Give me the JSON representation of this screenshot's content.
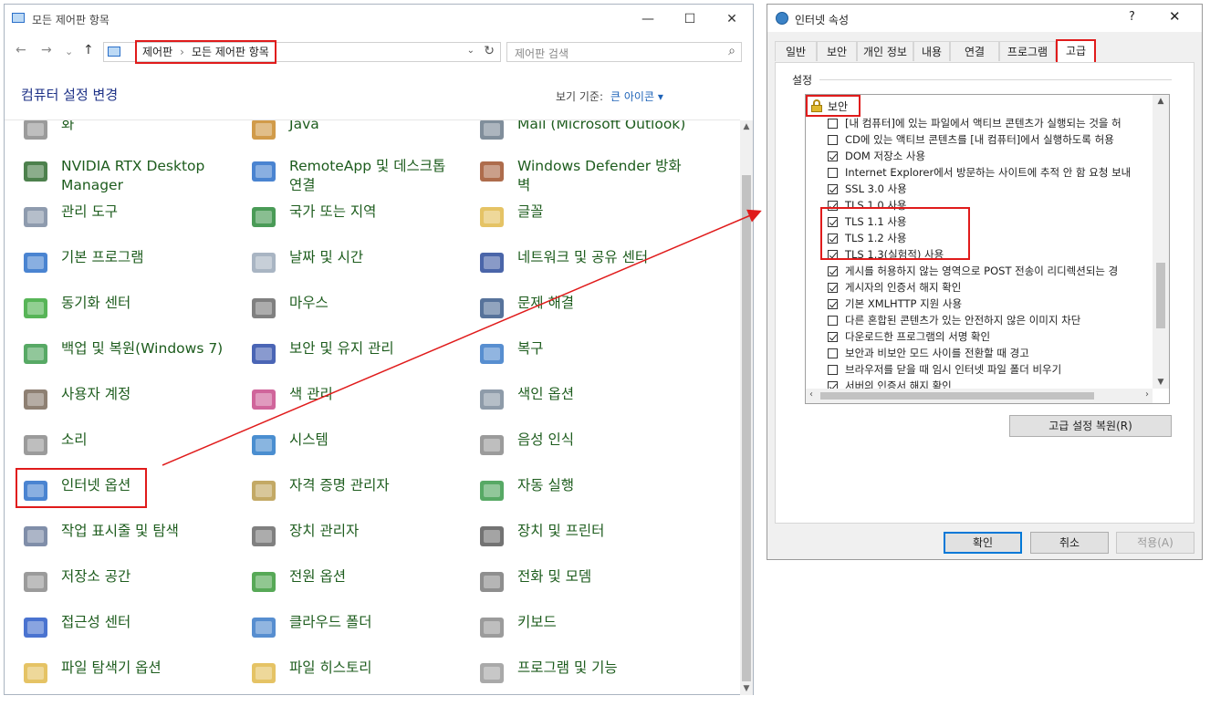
{
  "control_panel": {
    "title": "모든 제어판 항목",
    "caption_buttons": {
      "minimize": "—",
      "maximize": "☐",
      "close": "✕"
    },
    "nav": {
      "back": "←",
      "forward": "→",
      "dropdown": "⌄",
      "up": "↑"
    },
    "breadcrumb": {
      "root": "제어판",
      "separator": "›",
      "current": "모든 제어판 항목"
    },
    "address_dropdown": "⌄",
    "refresh": "↻",
    "search_placeholder": "제어판 검색",
    "search_icon": "⌕",
    "heading": "컴퓨터 설정 변경",
    "view_by_label": "보기 기준:",
    "view_by_value": "큰 아이콘 ▾",
    "scroll_up": "▲",
    "scroll_down": "▼",
    "items": [
      {
        "label": "화",
        "icon": "keys-icon"
      },
      {
        "label": "Java",
        "icon": "java-icon"
      },
      {
        "label": "Mail (Microsoft Outlook)",
        "icon": "mail-icon"
      },
      {
        "label": "NVIDIA RTX Desktop Manager",
        "icon": "nvidia-icon"
      },
      {
        "label": "RemoteApp 및 데스크톱 연결",
        "icon": "remoteapp-icon"
      },
      {
        "label": "Windows Defender 방화벽",
        "icon": "firewall-icon"
      },
      {
        "label": "관리 도구",
        "icon": "admin-tools-icon"
      },
      {
        "label": "국가 또는 지역",
        "icon": "globe-clock-icon"
      },
      {
        "label": "글꼴",
        "icon": "font-folder-icon"
      },
      {
        "label": "기본 프로그램",
        "icon": "default-programs-icon"
      },
      {
        "label": "날짜 및 시간",
        "icon": "calendar-clock-icon"
      },
      {
        "label": "네트워크 및 공유 센터",
        "icon": "network-icon"
      },
      {
        "label": "동기화 센터",
        "icon": "sync-icon"
      },
      {
        "label": "마우스",
        "icon": "mouse-icon"
      },
      {
        "label": "문제 해결",
        "icon": "troubleshoot-icon"
      },
      {
        "label": "백업 및 복원(Windows 7)",
        "icon": "backup-icon"
      },
      {
        "label": "보안 및 유지 관리",
        "icon": "flag-icon"
      },
      {
        "label": "복구",
        "icon": "recovery-icon"
      },
      {
        "label": "사용자 계정",
        "icon": "users-icon"
      },
      {
        "label": "색 관리",
        "icon": "color-management-icon"
      },
      {
        "label": "색인 옵션",
        "icon": "indexing-icon"
      },
      {
        "label": "소리",
        "icon": "speaker-icon"
      },
      {
        "label": "시스템",
        "icon": "system-icon"
      },
      {
        "label": "음성 인식",
        "icon": "microphone-icon"
      },
      {
        "label": "인터넷 옵션",
        "icon": "internet-options-icon"
      },
      {
        "label": "자격 증명 관리자",
        "icon": "credential-vault-icon"
      },
      {
        "label": "자동 실행",
        "icon": "autoplay-icon"
      },
      {
        "label": "작업 표시줄 및 탐색",
        "icon": "taskbar-icon"
      },
      {
        "label": "장치 관리자",
        "icon": "device-manager-icon"
      },
      {
        "label": "장치 및 프린터",
        "icon": "printer-icon"
      },
      {
        "label": "저장소 공간",
        "icon": "storage-icon"
      },
      {
        "label": "전원 옵션",
        "icon": "battery-icon"
      },
      {
        "label": "전화 및 모뎀",
        "icon": "phone-icon"
      },
      {
        "label": "접근성 센터",
        "icon": "accessibility-icon"
      },
      {
        "label": "클라우드 폴더",
        "icon": "cloud-folder-icon"
      },
      {
        "label": "키보드",
        "icon": "keyboard-icon"
      },
      {
        "label": "파일 탐색기 옵션",
        "icon": "folder-options-icon"
      },
      {
        "label": "파일 히스토리",
        "icon": "file-history-icon"
      },
      {
        "label": "프로그램 및 기능",
        "icon": "programs-features-icon"
      }
    ]
  },
  "internet_properties": {
    "title": "인터넷 속성",
    "help": "?",
    "close": "✕",
    "tabs": [
      "일반",
      "보안",
      "개인 정보",
      "내용",
      "연결",
      "프로그램",
      "고급"
    ],
    "active_tab": "고급",
    "group_label": "설정",
    "category": "보안",
    "scroll_up": "▲",
    "scroll_down": "▼",
    "scroll_left": "‹",
    "scroll_right": "›",
    "options": [
      {
        "label": "[내 컴퓨터]에 있는 파일에서 액티브 콘텐츠가 실행되는 것을 허",
        "checked": false
      },
      {
        "label": "CD에 있는 액티브 콘텐츠를 [내 컴퓨터]에서 실행하도록 허용",
        "checked": false
      },
      {
        "label": "DOM 저장소 사용",
        "checked": true
      },
      {
        "label": "Internet Explorer에서 방문하는 사이트에 추적 안 함 요청 보내",
        "checked": false
      },
      {
        "label": "SSL 3.0 사용",
        "checked": true
      },
      {
        "label": "TLS 1.0 사용",
        "checked": true
      },
      {
        "label": "TLS 1.1 사용",
        "checked": true
      },
      {
        "label": "TLS 1.2 사용",
        "checked": true
      },
      {
        "label": "TLS 1.3(실험적) 사용",
        "checked": true
      },
      {
        "label": "게시를 허용하지 않는 영역으로 POST 전송이 리디렉션되는 경",
        "checked": true
      },
      {
        "label": "게시자의 인증서 해지 확인",
        "checked": true
      },
      {
        "label": "기본 XMLHTTP 지원 사용",
        "checked": true
      },
      {
        "label": "다른 혼합된 콘텐츠가 있는 안전하지 않은 이미지 차단",
        "checked": false
      },
      {
        "label": "다운로드한 프로그램의 서명 확인",
        "checked": true
      },
      {
        "label": "보안과 비보안 모드 사이를 전환할 때 경고",
        "checked": false
      },
      {
        "label": "브라우저를 닫을 때 임시 인터넷 파일 폴더 비우기",
        "checked": false
      },
      {
        "label": "서버의 인증서 해지 확인",
        "checked": true
      }
    ],
    "restore_button": "고급 설정 복원(R)",
    "ok_button": "확인",
    "cancel_button": "취소",
    "apply_button": "적용(A)"
  },
  "colors": {
    "highlight": "#e01b1b",
    "item_text": "#1d5c1d",
    "heading": "#1e3287",
    "link": "#1e63b8"
  }
}
